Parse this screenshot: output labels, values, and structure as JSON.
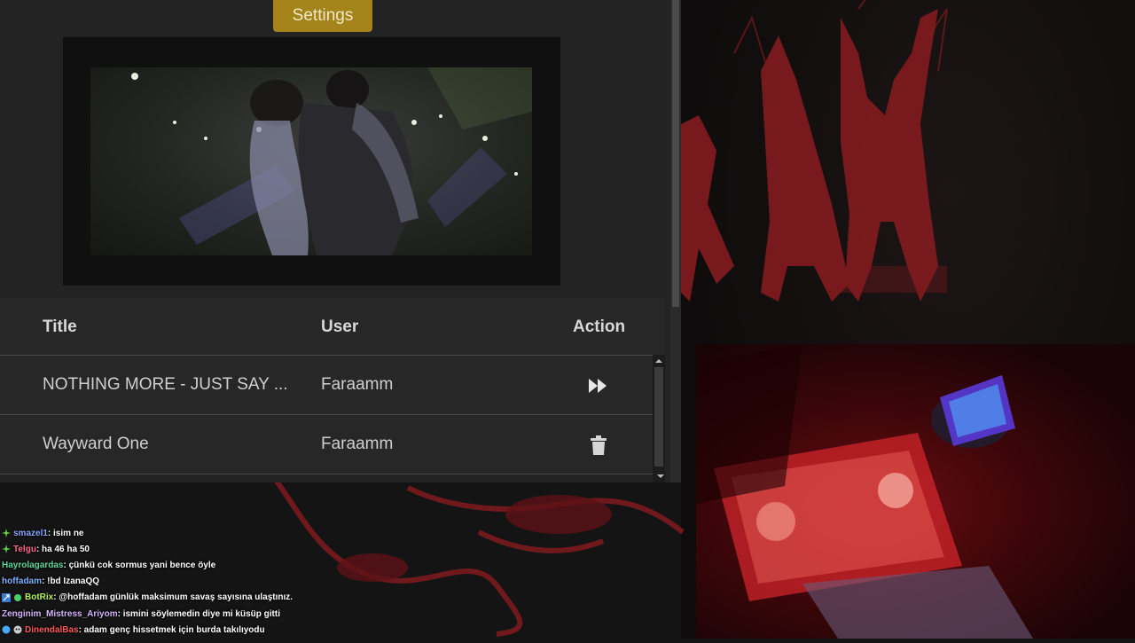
{
  "settings_button": {
    "label": "Settings",
    "color": "#a3831a"
  },
  "table": {
    "headers": {
      "title": "Title",
      "user": "User",
      "action": "Action"
    },
    "rows": [
      {
        "title": "NOTHING MORE - JUST SAY ...",
        "user": "Faraamm",
        "action_icon": "fast-forward-icon"
      },
      {
        "title": "Wayward One",
        "user": "Faraamm",
        "action_icon": "trash-icon"
      }
    ]
  },
  "chat": [
    {
      "badge": "green-plus-badge",
      "user": "smazel1",
      "user_color": "#8aa8ff",
      "message": " : isim ne"
    },
    {
      "badge": "green-plus-badge",
      "user": "Telgu",
      "user_color": "#ff6a8a",
      "message": " : ha 46 ha 50"
    },
    {
      "badge": "",
      "user": "Hayrolagardas",
      "user_color": "#5fd9a0",
      "message": " : çünkü cok sormus yani bence öyle"
    },
    {
      "badge": "",
      "user": "hoffadam",
      "user_color": "#7fb2ff",
      "message": " : !bd IzanaQQ"
    },
    {
      "badge": "bot-badges",
      "user": "BotRix",
      "user_color": "#b6f05a",
      "message": " : @hoffadam günlük maksimum savaş sayısına ulaştınız."
    },
    {
      "badge": "",
      "user": "Zenginim_Mistress_Ariyom",
      "user_color": "#d6b3ff",
      "message": " : ismini söylemedin diye mi küsüp gitti"
    },
    {
      "badge": "sub-badges",
      "user": "DinendalBas",
      "user_color": "#ff5a5a",
      "message": " : adam genç hissetmek için burda takılıyodu"
    }
  ]
}
